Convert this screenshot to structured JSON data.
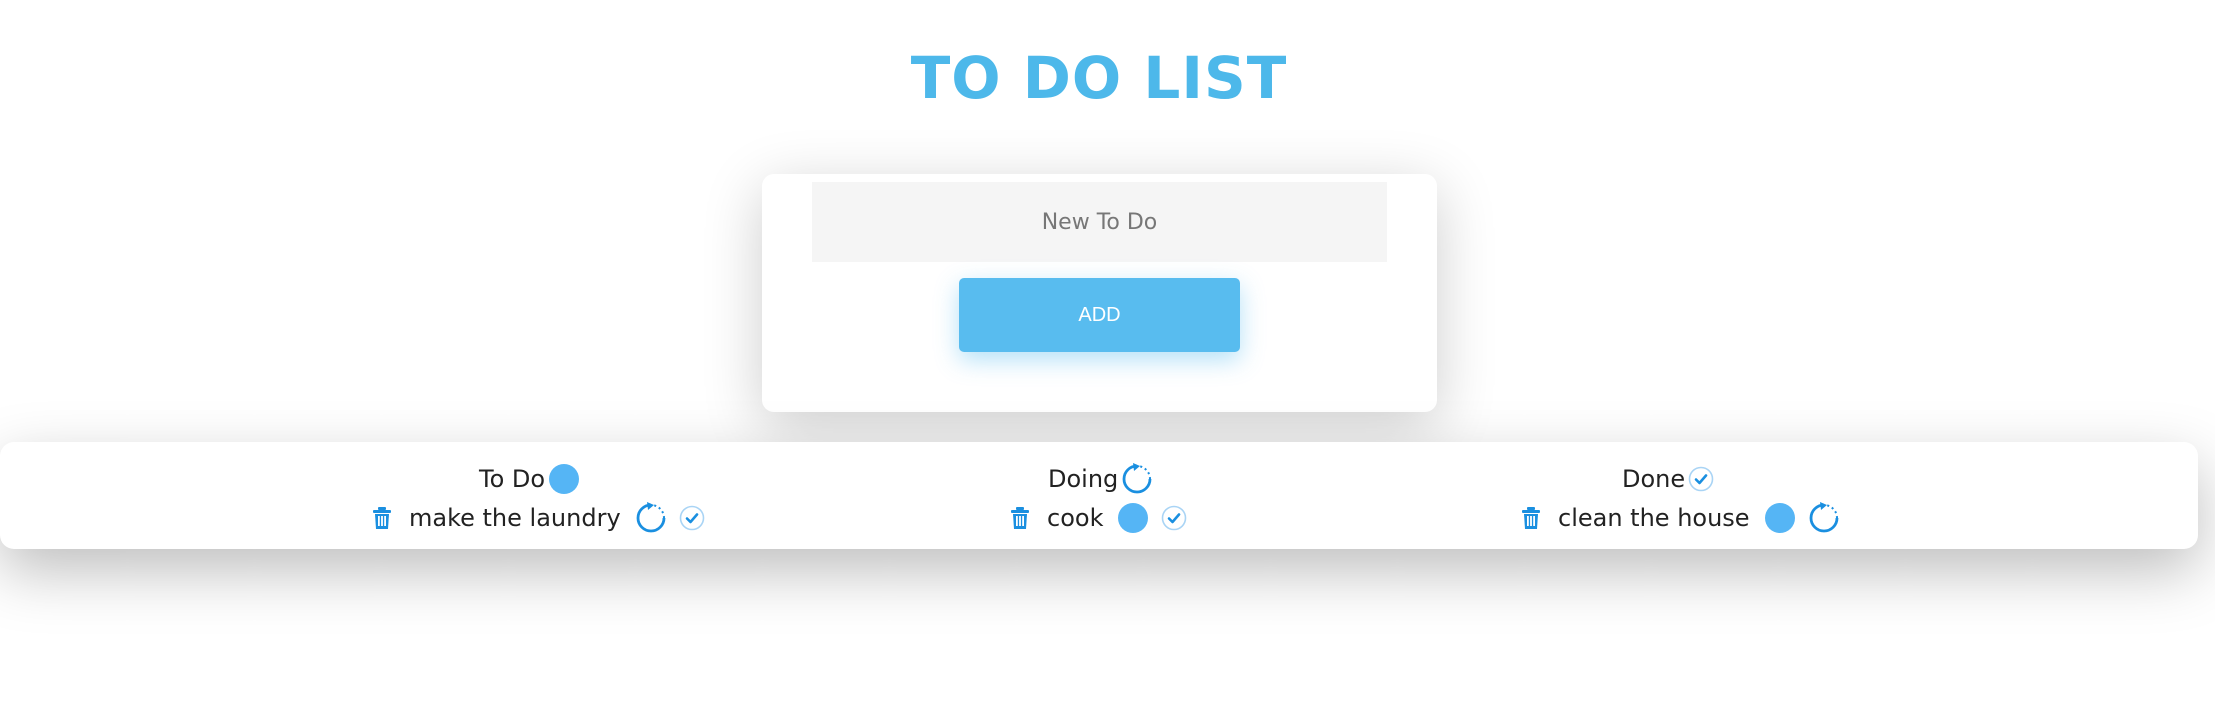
{
  "app": {
    "title": "TO DO LIST"
  },
  "form": {
    "input_value": "",
    "input_placeholder": "New To Do",
    "add_label": "ADD"
  },
  "columns": [
    {
      "title": "To Do",
      "title_icon": "filled-circle-icon",
      "items": [
        {
          "text": "make the laundry",
          "actions": [
            "trash-icon",
            "refresh-icon",
            "check-circle-icon"
          ]
        }
      ]
    },
    {
      "title": "Doing",
      "title_icon": "refresh-icon",
      "items": [
        {
          "text": "cook",
          "actions": [
            "trash-icon",
            "filled-circle-icon",
            "check-circle-icon"
          ]
        }
      ]
    },
    {
      "title": "Done",
      "title_icon": "check-circle-icon",
      "items": [
        {
          "text": "clean the house",
          "actions": [
            "trash-icon",
            "filled-circle-icon",
            "refresh-icon"
          ]
        }
      ]
    }
  ],
  "colors": {
    "accent": "#4db8ea",
    "button": "#58bcef",
    "icon_blue": "#1a8fe0",
    "circle_fill": "#55b5f5"
  }
}
